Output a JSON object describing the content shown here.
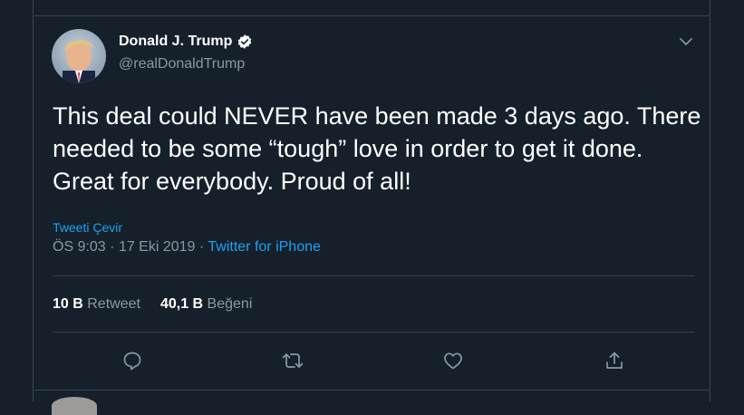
{
  "tweet": {
    "author_name": "Donald J. Trump",
    "handle": "@realDonaldTrump",
    "text": "This deal could NEVER have been made 3 days ago. There needed to be some “tough” love in order to get it done. Great for everybody. Proud of all!",
    "translate_label": "Tweeti Çevir",
    "time": "ÖS 9:03",
    "date": "17 Eki 2019",
    "separator": "·",
    "source": "Twitter for iPhone",
    "retweet_count": "10 B",
    "retweet_label": "Retweet",
    "like_count": "40,1 B",
    "like_label": "Beğeni"
  },
  "icons": {
    "verified": "verified-badge-icon",
    "caret": "chevron-down-icon",
    "reply": "reply-icon",
    "retweet": "retweet-icon",
    "like": "heart-icon",
    "share": "share-icon"
  },
  "colors": {
    "background": "#15202b",
    "accent": "#1da1f2",
    "muted": "#8899a6",
    "border": "#38444d"
  }
}
